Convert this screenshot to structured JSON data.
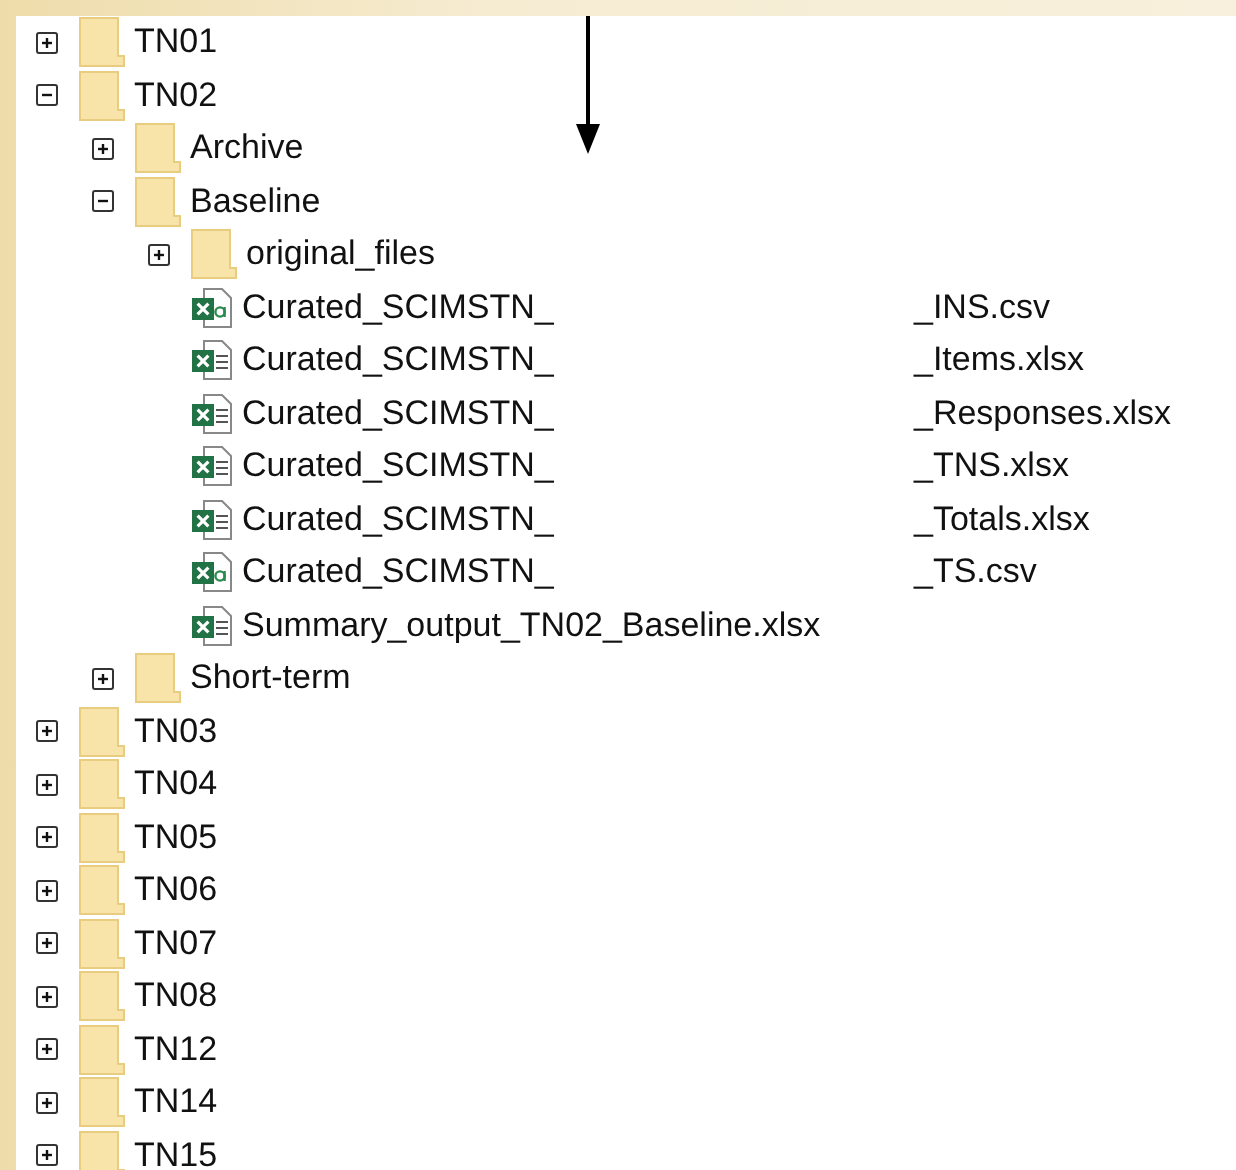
{
  "tree": [
    {
      "kind": "folder",
      "name": "TN01",
      "expanded": false
    },
    {
      "kind": "folder",
      "name": "TN02",
      "expanded": true,
      "children": [
        {
          "kind": "folder",
          "name": "Archive",
          "expanded": false
        },
        {
          "kind": "folder",
          "name": "Baseline",
          "expanded": true,
          "children": [
            {
              "kind": "folder",
              "name": "original_files",
              "expanded": false
            },
            {
              "kind": "csv",
              "name": "Curated_SCIMSTN_",
              "name_end": "_INS.csv"
            },
            {
              "kind": "sheet",
              "name": "Curated_SCIMSTN_",
              "name_end": "_Items.xlsx"
            },
            {
              "kind": "sheet",
              "name": "Curated_SCIMSTN_",
              "name_end": "_Responses.xlsx"
            },
            {
              "kind": "sheet",
              "name": "Curated_SCIMSTN_",
              "name_end": "_TNS.xlsx"
            },
            {
              "kind": "sheet",
              "name": "Curated_SCIMSTN_",
              "name_end": "_Totals.xlsx"
            },
            {
              "kind": "csv",
              "name": "Curated_SCIMSTN_",
              "name_end": "_TS.csv"
            },
            {
              "kind": "sheet",
              "name": "Summary_output_TN02_Baseline.xlsx"
            }
          ]
        },
        {
          "kind": "folder",
          "name": "Short-term",
          "expanded": false
        }
      ]
    },
    {
      "kind": "folder",
      "name": "TN03",
      "expanded": false
    },
    {
      "kind": "folder",
      "name": "TN04",
      "expanded": false
    },
    {
      "kind": "folder",
      "name": "TN05",
      "expanded": false
    },
    {
      "kind": "folder",
      "name": "TN06",
      "expanded": false
    },
    {
      "kind": "folder",
      "name": "TN07",
      "expanded": false
    },
    {
      "kind": "folder",
      "name": "TN08",
      "expanded": false
    },
    {
      "kind": "folder",
      "name": "TN12",
      "expanded": false
    },
    {
      "kind": "folder",
      "name": "TN14",
      "expanded": false
    },
    {
      "kind": "folder",
      "name": "TN15",
      "expanded": false
    }
  ]
}
